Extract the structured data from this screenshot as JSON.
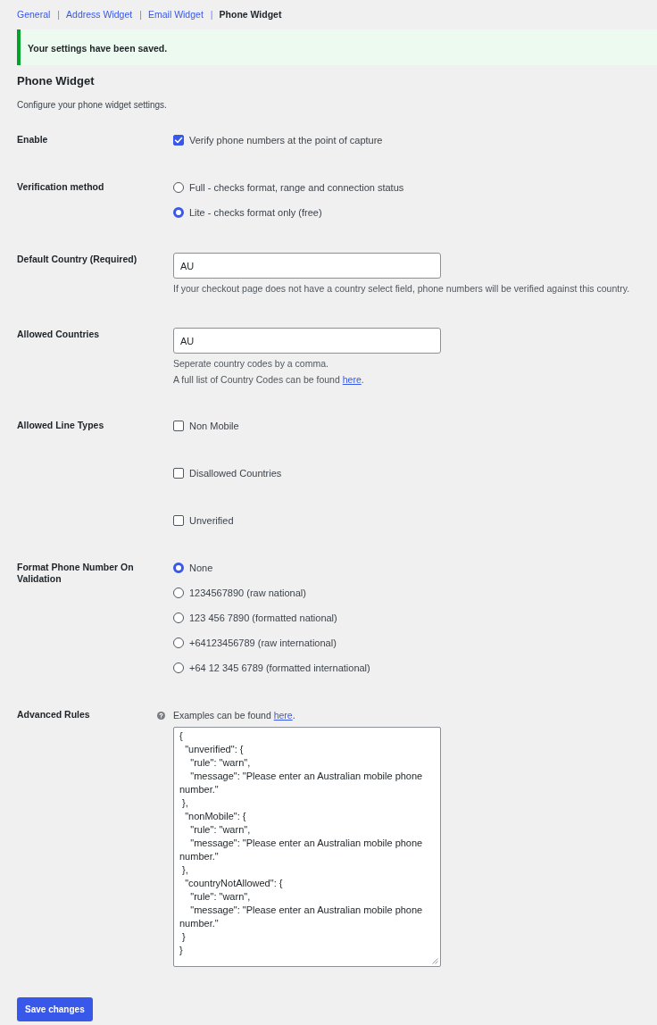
{
  "nav": [
    {
      "label": "General",
      "selected": false
    },
    {
      "separator": "|",
      "label": "Address Widget",
      "selected": false
    },
    {
      "separator": "|",
      "label": "Email Widget",
      "selected": false
    },
    {
      "separator": "|",
      "label": "Phone Widget",
      "selected": true
    }
  ],
  "notice": {
    "text": "Your settings have been saved."
  },
  "heading": "Phone Widget",
  "intro": "Configure your phone widget settings.",
  "fields": [
    {
      "kind": "checkbox-group",
      "label": "Enable",
      "options": [
        {
          "label": "Verify phone numbers at the point of capture",
          "checked": true
        }
      ]
    },
    {
      "kind": "radio-group",
      "label": "Verification method",
      "options": [
        {
          "label": "Full - checks format, range and connection status",
          "selected": false
        },
        {
          "label": "Lite - checks format only (free)",
          "selected": true
        }
      ]
    },
    {
      "kind": "text",
      "label": "Default Country (Required)",
      "value": "AU",
      "descriptions": [
        {
          "text": "If your checkout page does not have a country select field, phone numbers will be verified against this country."
        }
      ]
    },
    {
      "kind": "text",
      "label": "Allowed Countries",
      "value": "AU",
      "descriptions": [
        {
          "text": "Seperate country codes by a comma."
        },
        {
          "text": "A full list of Country Codes can be found",
          "link": "here",
          "after": "."
        }
      ]
    },
    {
      "kind": "checkbox-group",
      "label": "Allowed Line Types",
      "options": [
        {
          "label": "Non Mobile",
          "checked": false
        },
        {
          "label": "Disallowed Countries",
          "checked": false
        },
        {
          "label": "Unverified",
          "checked": false
        }
      ]
    },
    {
      "kind": "radio-group",
      "label": "Format Phone Number On Validation",
      "options": [
        {
          "label": "None",
          "selected": true
        },
        {
          "label": "1234567890 (raw national)",
          "selected": false
        },
        {
          "label": "123 456 7890 (formatted national)",
          "selected": false
        },
        {
          "label": "+64123456789 (raw international)",
          "selected": false
        },
        {
          "label": "+64 12 345 6789 (formatted international)",
          "selected": false
        }
      ]
    },
    {
      "kind": "code",
      "label": "Advanced Rules",
      "descriptions": [
        {
          "text": "Examples can be found",
          "link": "here",
          "after": "."
        }
      ],
      "value": "{\n  \"unverified\": {\n    \"rule\": \"warn\",\n    \"message\": \"Please enter an Australian mobile phone number.\"\n },\n  \"nonMobile\": {\n    \"rule\": \"warn\",\n    \"message\": \"Please enter an Australian mobile phone number.\"\n },\n  \"countryNotAllowed\": {\n    \"rule\": \"warn\",\n    \"message\": \"Please enter an Australian mobile phone number.\"\n }\n}"
    }
  ],
  "save_button": "Save changes"
}
